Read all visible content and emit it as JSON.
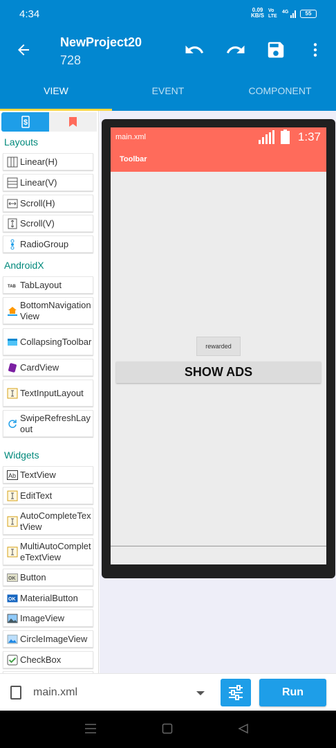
{
  "status_bar": {
    "time": "4:34",
    "net_speed": "0.09",
    "net_unit": "KB/S",
    "volte": "Vo LTE",
    "network": "4G",
    "battery": "55"
  },
  "app_bar": {
    "title": "NewProject20",
    "subtitle": "728",
    "tabs": [
      {
        "label": "VIEW",
        "active": true
      },
      {
        "label": "EVENT",
        "active": false
      },
      {
        "label": "COMPONENT",
        "active": false
      }
    ]
  },
  "palette": {
    "sections": {
      "layouts": "Layouts",
      "androidx": "AndroidX",
      "widgets": "Widgets"
    },
    "layouts": [
      "Linear(H)",
      "Linear(V)",
      "Scroll(H)",
      "Scroll(V)",
      "RadioGroup"
    ],
    "androidx": [
      "TabLayout",
      "BottomNavigationView",
      "CollapsingToolbar",
      "CardView",
      "TextInputLayout",
      "SwipeRefreshLayout"
    ],
    "widgets": [
      "TextView",
      "EditText",
      "AutoCompleteTextView",
      "MultiAutoCompleteTextView",
      "Button",
      "MaterialButton",
      "ImageView",
      "CircleImageView",
      "CheckBox"
    ]
  },
  "preview": {
    "file_name": "main.xml",
    "clock": "1:37",
    "toolbar_title": "Toolbar",
    "rewarded_label": "rewarded",
    "show_ads_label": "SHOW ADS",
    "accent_color": "#ff6b5b"
  },
  "bottom_bar": {
    "file_name": "main.xml",
    "run_label": "Run"
  },
  "colors": {
    "primary": "#0287d0",
    "accent_button": "#1e9ee8",
    "tab_indicator": "#ffd740",
    "section_text": "#00897b"
  }
}
